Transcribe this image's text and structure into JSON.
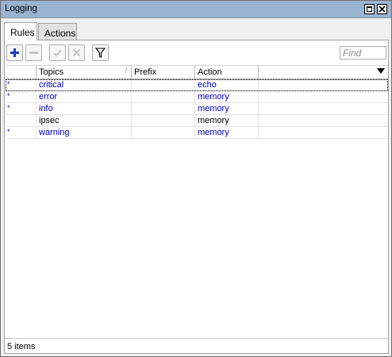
{
  "window": {
    "title": "Logging",
    "maximize_icon": "maximize-icon",
    "close_icon": "close-icon"
  },
  "tabs": [
    {
      "label": "Rules",
      "active": true
    },
    {
      "label": "Actions",
      "active": false
    }
  ],
  "toolbar": {
    "add_icon": "plus-icon",
    "remove_icon": "minus-icon",
    "enable_icon": "check-icon",
    "disable_icon": "x-icon",
    "filter_icon": "filter-icon",
    "find_placeholder": "Find"
  },
  "table": {
    "columns": [
      "",
      "Topics",
      "Prefix",
      "Action"
    ],
    "rows": [
      {
        "flag": "*",
        "topics": "critical",
        "prefix": "",
        "action": "echo",
        "dynamic": true
      },
      {
        "flag": "*",
        "topics": "error",
        "prefix": "",
        "action": "memory",
        "dynamic": true
      },
      {
        "flag": "*",
        "topics": "info",
        "prefix": "",
        "action": "memory",
        "dynamic": true
      },
      {
        "flag": "",
        "topics": "ipsec",
        "prefix": "",
        "action": "memory",
        "dynamic": false
      },
      {
        "flag": "*",
        "topics": "warning",
        "prefix": "",
        "action": "memory",
        "dynamic": true
      }
    ]
  },
  "status": {
    "items_text": "5 items"
  },
  "colors": {
    "titlebar": "#99b4d1",
    "dynamic_text": "#0000c0",
    "add_button": "#1a3fc0"
  }
}
